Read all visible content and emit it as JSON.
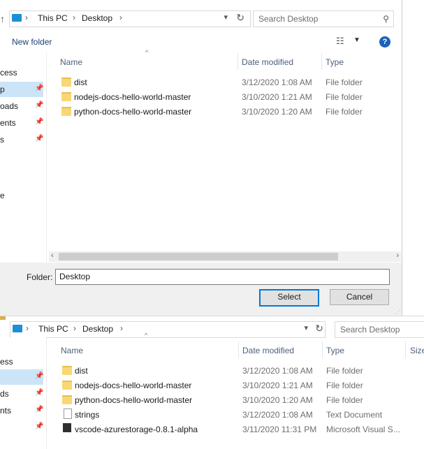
{
  "dialog": {
    "breadcrumb": [
      "This PC",
      "Desktop"
    ],
    "search_placeholder": "Search Desktop",
    "new_folder": "New folder",
    "view_icon": "view-list-icon",
    "nav_items": [
      "cess",
      "p",
      "oads",
      "ents",
      "s",
      "e"
    ],
    "columns": {
      "name": "Name",
      "date": "Date modified",
      "type": "Type"
    },
    "rows": [
      {
        "name": "dist",
        "date": "3/12/2020 1:08 AM",
        "type": "File folder"
      },
      {
        "name": "nodejs-docs-hello-world-master",
        "date": "3/10/2020 1:21 AM",
        "type": "File folder"
      },
      {
        "name": "python-docs-hello-world-master",
        "date": "3/10/2020 1:20 AM",
        "type": "File folder"
      }
    ],
    "folder_label": "Folder:",
    "folder_value": "Desktop",
    "select_button": "Select",
    "cancel_button": "Cancel"
  },
  "background_window": {
    "breadcrumb": [
      "This PC",
      "Desktop"
    ],
    "search_placeholder": "Search Desktop",
    "nav_items": [
      "ess",
      "",
      "ds",
      "nts"
    ],
    "columns": {
      "name": "Name",
      "date": "Date modified",
      "type": "Type",
      "size": "Size"
    },
    "rows": [
      {
        "name": "dist",
        "date": "3/12/2020 1:08 AM",
        "type": "File folder",
        "icon": "folder-icon"
      },
      {
        "name": "nodejs-docs-hello-world-master",
        "date": "3/10/2020 1:21 AM",
        "type": "File folder",
        "icon": "folder-icon"
      },
      {
        "name": "python-docs-hello-world-master",
        "date": "3/10/2020 1:20 AM",
        "type": "File folder",
        "icon": "folder-icon"
      },
      {
        "name": "strings",
        "date": "3/12/2020 1:08 AM",
        "type": "Text Document",
        "icon": "text-document-icon"
      },
      {
        "name": "vscode-azurestorage-0.8.1-alpha",
        "date": "3/11/2020 11:31 PM",
        "type": "Microsoft Visual S...",
        "icon": "vscode-package-icon"
      }
    ]
  },
  "colors": {
    "accent": "#0078d7",
    "selected": "#cce4f7",
    "folder": "#f8d775"
  }
}
